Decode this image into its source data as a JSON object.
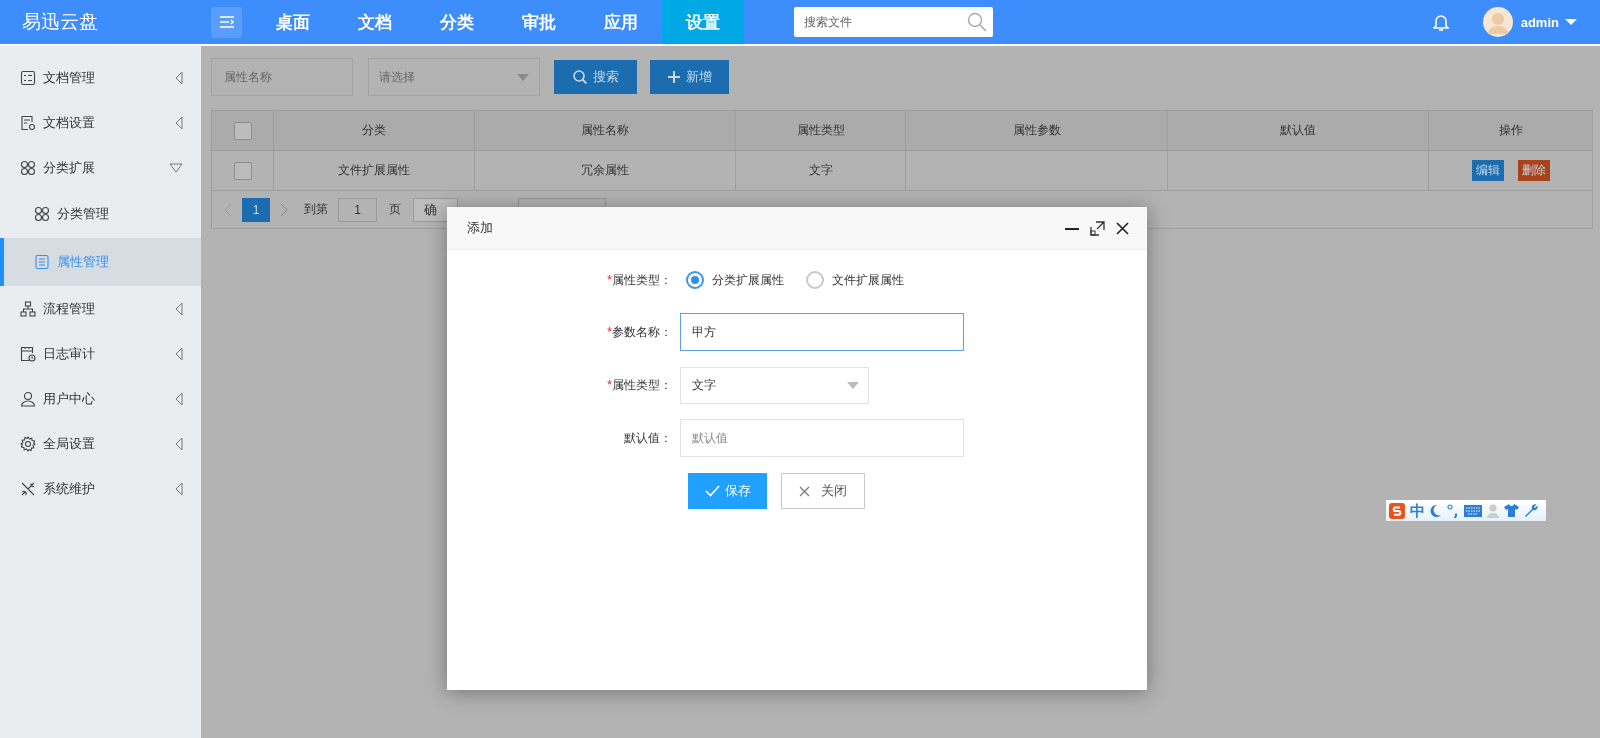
{
  "header": {
    "logo": "易迅云盘",
    "nav": [
      {
        "label": "桌面",
        "selected": false
      },
      {
        "label": "文档",
        "selected": false
      },
      {
        "label": "分类",
        "selected": false
      },
      {
        "label": "审批",
        "selected": false
      },
      {
        "label": "应用",
        "selected": false
      },
      {
        "label": "设置",
        "selected": true
      }
    ],
    "search": {
      "placeholder": "搜索文件"
    },
    "user": "admin"
  },
  "sidebar": {
    "items": [
      {
        "label": "文档管理",
        "expanded": false
      },
      {
        "label": "文档设置",
        "expanded": false
      },
      {
        "label": "分类扩展",
        "expanded": true,
        "children": [
          {
            "label": "分类管理",
            "selected": false
          },
          {
            "label": "属性管理",
            "selected": true
          }
        ]
      },
      {
        "label": "流程管理",
        "expanded": false
      },
      {
        "label": "日志审计",
        "expanded": false
      },
      {
        "label": "用户中心",
        "expanded": false
      },
      {
        "label": "全局设置",
        "expanded": false
      },
      {
        "label": "系统维护",
        "expanded": false
      }
    ]
  },
  "toolbar": {
    "name_field": {
      "placeholder": "属性名称"
    },
    "type_select": {
      "placeholder": "请选择"
    },
    "buttons": [
      "搜索",
      "新增"
    ]
  },
  "table": {
    "header_checked": false,
    "columns": [
      "分类",
      "属性名称",
      "属性类型",
      "属性参数",
      "默认值",
      "操作"
    ],
    "rows": [
      {
        "checked": false,
        "category": "文件扩展属性",
        "name": "冗余属性",
        "type": "文字",
        "actions": [
          "编辑",
          "删除"
        ]
      }
    ]
  },
  "pager": {
    "pages": [
      {
        "label": "1",
        "selected": true
      }
    ],
    "goto_label": "到第",
    "goto_value": "1",
    "page_unit": "页",
    "confirm": "确"
  },
  "dialog": {
    "title": "添加",
    "fields": [
      {
        "kind": "radio",
        "mark": "*",
        "label": "属性类型：",
        "options": [
          {
            "label": "分类扩展属性",
            "selected": true
          },
          {
            "label": "文件扩展属性",
            "selected": false
          }
        ]
      },
      {
        "kind": "text",
        "mark": "*",
        "label": "参数名称：",
        "value": "甲方",
        "focused": true
      },
      {
        "kind": "select",
        "mark": "*",
        "label": "属性类型：",
        "value": "文字"
      },
      {
        "kind": "text",
        "label": "默认值：",
        "placeholder": "默认值",
        "focused": false
      }
    ],
    "buttons": [
      {
        "kind": "primary",
        "label": "保存"
      },
      {
        "kind": "plain",
        "label": "关闭"
      }
    ]
  },
  "ime": {
    "mode": "中"
  }
}
